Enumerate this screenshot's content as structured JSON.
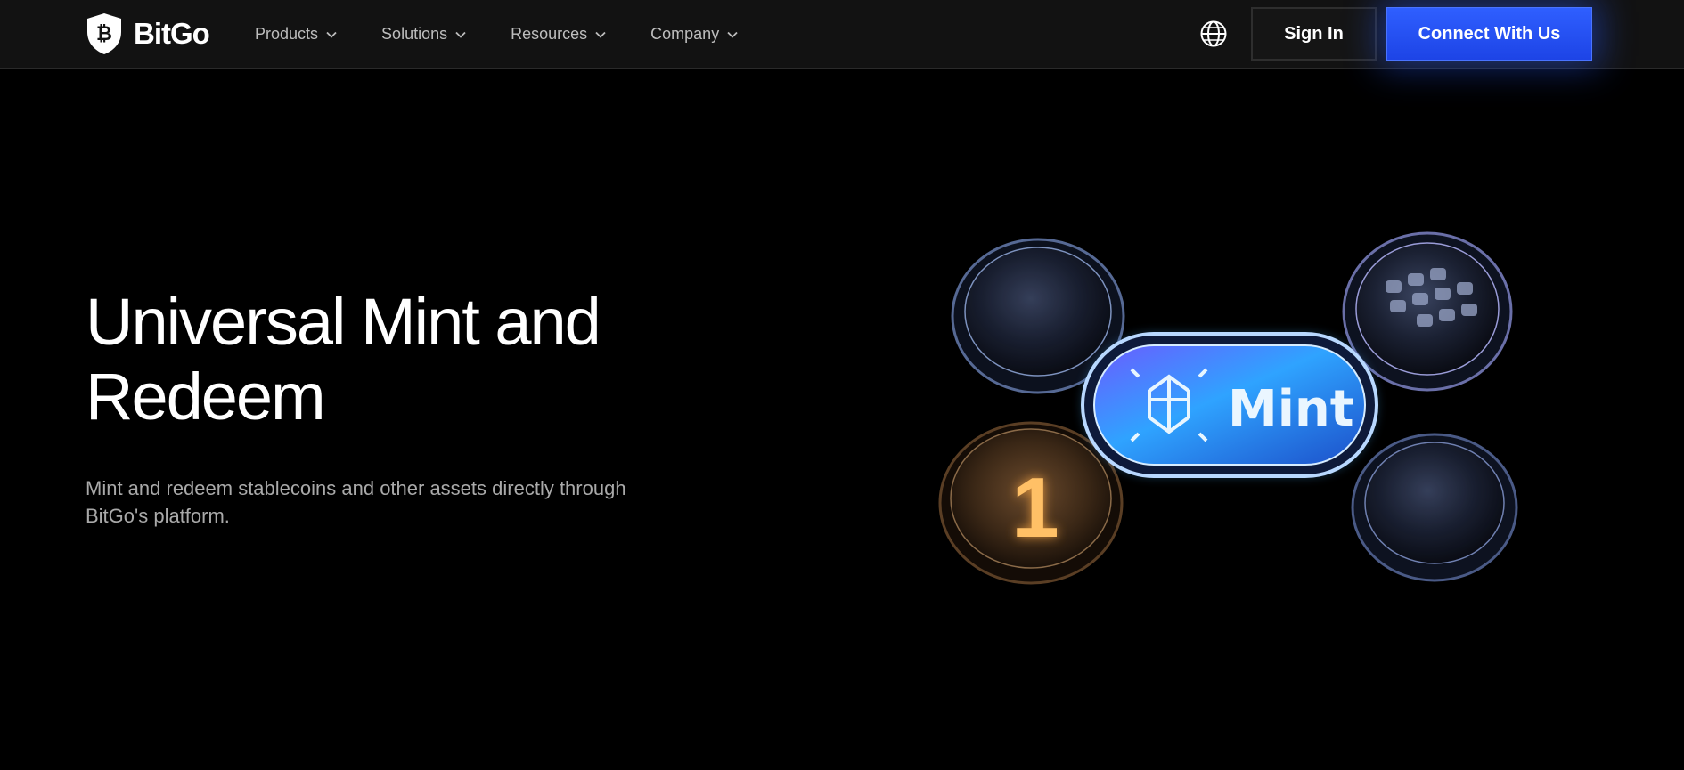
{
  "brand": {
    "name": "BitGo"
  },
  "nav": {
    "items": [
      {
        "label": "Products"
      },
      {
        "label": "Solutions"
      },
      {
        "label": "Resources"
      },
      {
        "label": "Company"
      }
    ],
    "sign_in": "Sign In",
    "connect": "Connect With Us"
  },
  "hero": {
    "title": "Universal Mint and Redeem",
    "subtitle": "Mint and redeem stablecoins and other assets directly through BitGo's platform.",
    "badge_label": "Mint",
    "coin_label": "1"
  },
  "colors": {
    "accent": "#1d44e6",
    "background": "#000000",
    "nav_background": "#121212"
  }
}
